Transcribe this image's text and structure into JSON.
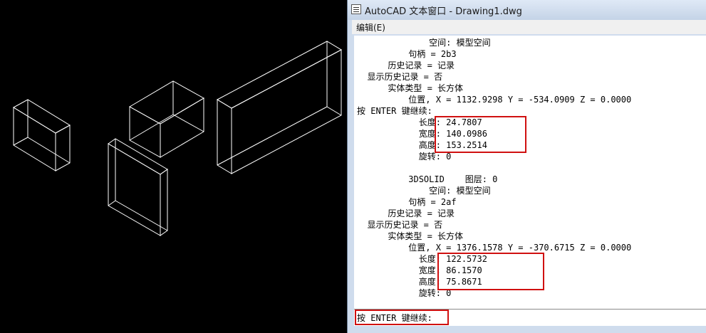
{
  "window": {
    "title": "AutoCAD 文本窗口 - Drawing1.dwg",
    "menu_edit": "编辑(E)"
  },
  "lines": [
    "              空间: 模型空间",
    "          句柄 = 2b3",
    "      历史记录 = 记录",
    "  显示历史记录 = 否",
    "      实体类型 = 长方体",
    "          位置, X = 1132.9298 Y = -534.0909 Z = 0.0000",
    "按 ENTER 键继续:",
    "            长度: 24.7807",
    "            宽度: 140.0986",
    "            高度: 153.2514",
    "            旋转: 0",
    "",
    "          3DSOLID    图层: 0",
    "              空间: 模型空间",
    "          句柄 = 2af",
    "      历史记录 = 记录",
    "  显示历史记录 = 否",
    "      实体类型 = 长方体",
    "          位置, X = 1376.1578 Y = -370.6715 Z = 0.0000",
    "            长度: 122.5732",
    "            宽度: 86.1570",
    "            高度: 75.8671",
    "            旋转: 0"
  ],
  "command_prompt": "按 ENTER 键继续:",
  "colors": {
    "highlight": "#d01010",
    "wireframe": "#ffffff"
  }
}
